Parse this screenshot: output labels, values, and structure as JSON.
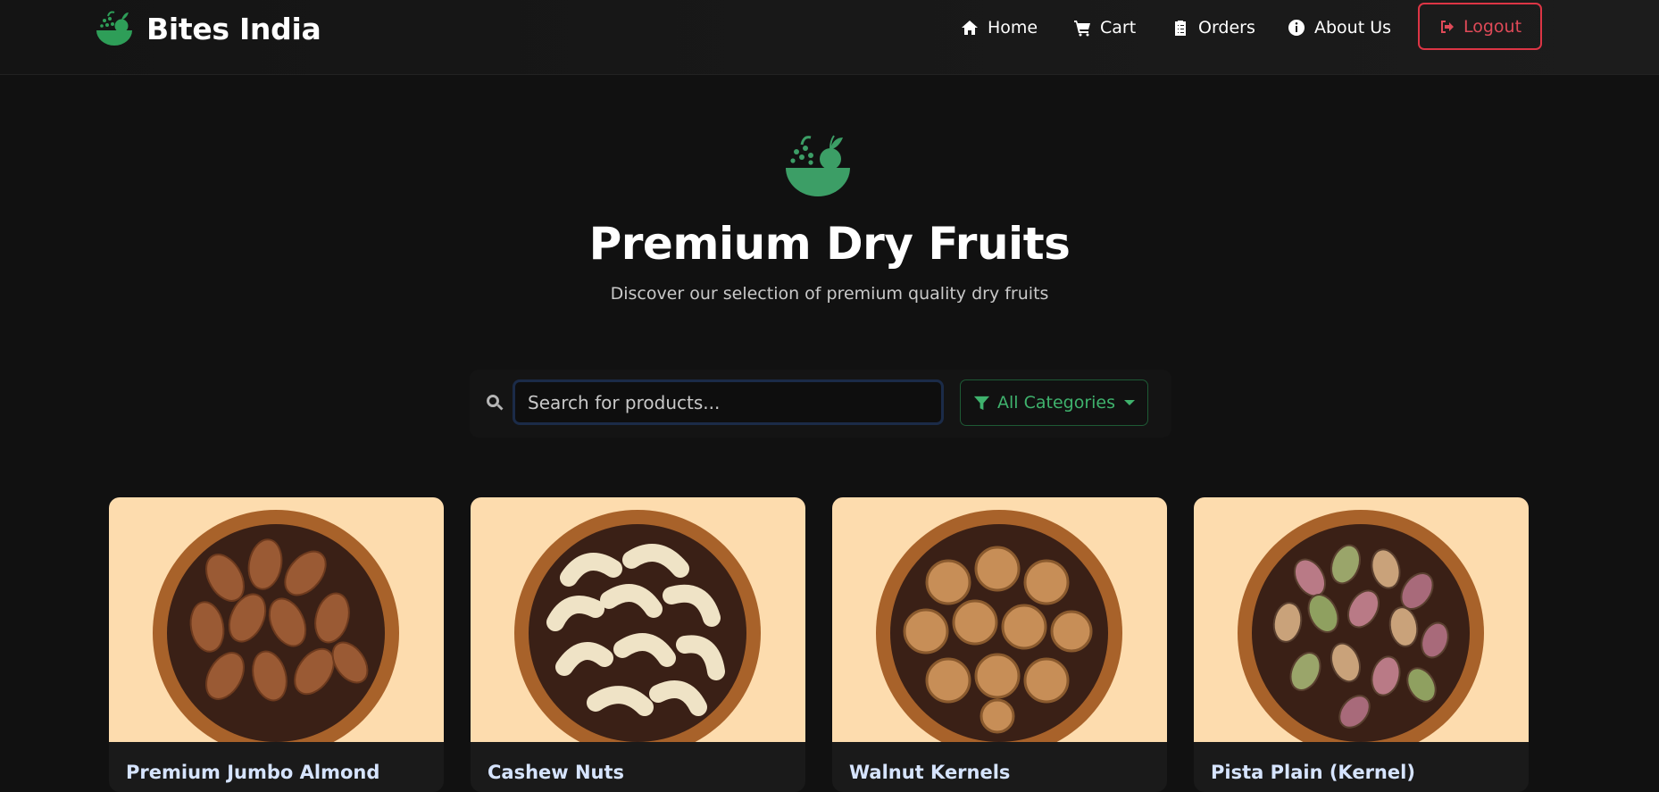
{
  "brand": {
    "name": "Bites India",
    "accent": "#2e9e58"
  },
  "nav": {
    "home": "Home",
    "cart": "Cart",
    "orders": "Orders",
    "about": "About Us",
    "logout": "Logout"
  },
  "hero": {
    "title": "Premium Dry Fruits",
    "subtitle": "Discover our selection of premium quality dry fruits"
  },
  "search": {
    "placeholder": "Search for products...",
    "value": "",
    "category": "All Categories"
  },
  "products": [
    {
      "name": "Premium Jumbo Almond",
      "image": "almonds-bowl",
      "nut_color": "#9a5a34"
    },
    {
      "name": "Cashew Nuts",
      "image": "cashews-bowl",
      "nut_color": "#efe3c6"
    },
    {
      "name": "Walnut Kernels",
      "image": "walnuts-bowl",
      "nut_color": "#c78e57"
    },
    {
      "name": "Pista Plain (Kernel)",
      "image": "pistachios-bowl",
      "nut_color": "#a87a6a"
    }
  ],
  "colors": {
    "background": "#111111",
    "logout": "#dc3545",
    "category_button": "#3fb26d",
    "product_image_bg": "#fddcae",
    "product_title": "#d6e4ff"
  }
}
